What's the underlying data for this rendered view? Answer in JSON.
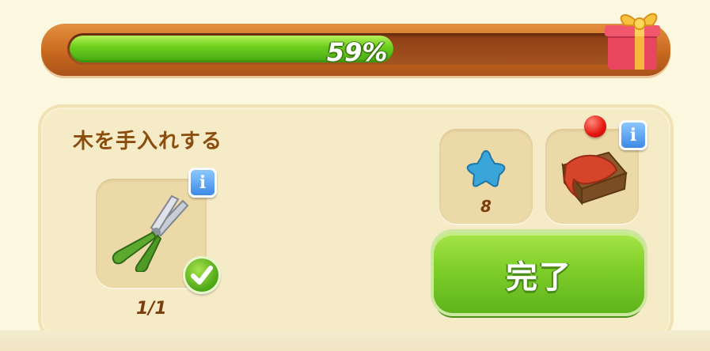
{
  "progress": {
    "value": 0.59,
    "label": "59%"
  },
  "reward": {
    "icon": "gift-box-icon"
  },
  "task": {
    "title": "木を手入れする",
    "tool": {
      "icon": "pruning-shears-icon",
      "count": "1/1",
      "completed": true,
      "info_label": "i"
    },
    "rewards": [
      {
        "icon": "blue-star-icon",
        "count": "8"
      },
      {
        "icon": "wooden-crate-red-cloth-icon",
        "info_label": "i"
      }
    ],
    "complete_button": {
      "label": "完了",
      "has_notification": true
    }
  },
  "colors": {
    "green_fill": "#6fd01f",
    "frame": "#c9691f",
    "title": "#8a4d0e"
  }
}
